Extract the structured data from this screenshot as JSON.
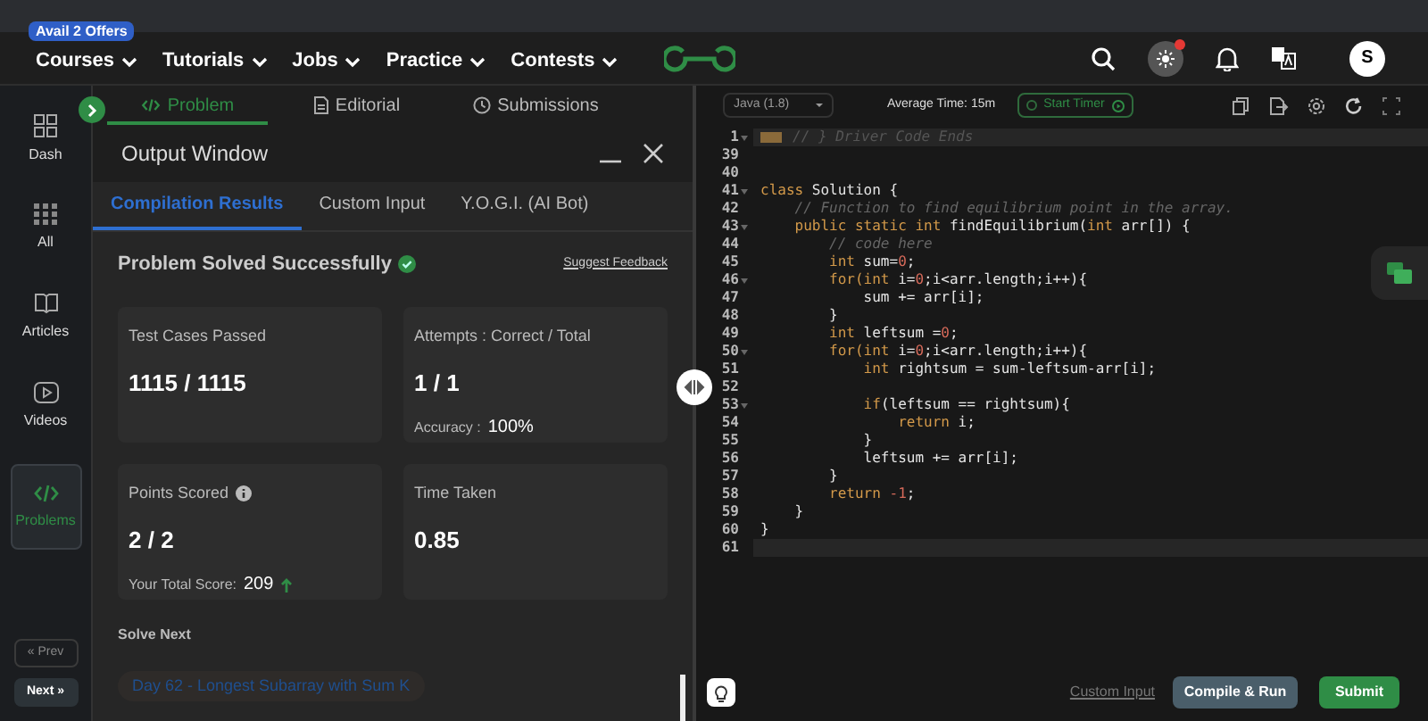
{
  "nav": {
    "offer_badge": "Avail 2 Offers",
    "menus": [
      {
        "label": "Courses"
      },
      {
        "label": "Tutorials"
      },
      {
        "label": "Jobs"
      },
      {
        "label": "Practice"
      },
      {
        "label": "Contests"
      }
    ],
    "avatar": "S",
    "notification_dot": true
  },
  "sidebar": {
    "items": [
      {
        "label": "Dash",
        "selected": false
      },
      {
        "label": "All",
        "selected": false
      },
      {
        "label": "Articles",
        "selected": false
      },
      {
        "label": "Videos",
        "selected": false
      },
      {
        "label": "Problems",
        "selected": true
      }
    ],
    "prev": "« Prev",
    "next": "Next »"
  },
  "problem_tabs": [
    {
      "label": "Problem",
      "selected": true
    },
    {
      "label": "Editorial",
      "selected": false
    },
    {
      "label": "Submissions",
      "selected": false
    }
  ],
  "output_window": {
    "title": "Output Window",
    "tabs": [
      {
        "label": "Compilation Results",
        "selected": true
      },
      {
        "label": "Custom Input",
        "selected": false
      },
      {
        "label": "Y.O.G.I. (AI Bot)",
        "selected": false
      }
    ],
    "status": "Problem Solved Successfully",
    "feedback_link": "Suggest Feedback",
    "cards": [
      {
        "label": "Test Cases Passed",
        "value": "1115 / 1115"
      },
      {
        "label": "Attempts : Correct / Total",
        "value": "1 / 1",
        "sub_label": "Accuracy :",
        "sub_value": "100%"
      },
      {
        "label": "Points Scored",
        "info": true,
        "value": "2 / 2",
        "sub_label": "Your Total Score:",
        "sub_value": "209",
        "trend_up": true
      },
      {
        "label": "Time Taken",
        "value": "0.85"
      }
    ],
    "solve_next": {
      "heading": "Solve Next",
      "items": [
        "Day 62 - Longest Subarray with Sum K"
      ]
    }
  },
  "editor": {
    "language": "Java (1.8)",
    "average_time": "Average Time: 15m",
    "timer_button": "Start Timer",
    "lines": [
      {
        "n": "1",
        "fold": true,
        "highlight": true,
        "marker": true,
        "tokens": [
          {
            "text": "// } Driver Code Ends",
            "kind": "faint"
          }
        ]
      },
      {
        "n": "39",
        "fold": false,
        "highlight": false
      },
      {
        "n": "40",
        "fold": false,
        "highlight": false
      },
      {
        "n": "41",
        "fold": true,
        "highlight": false,
        "tokens": [
          {
            "text": "class",
            "kind": "keyword"
          },
          {
            "text": " Solution {",
            "kind": "plain"
          }
        ]
      },
      {
        "n": "42",
        "fold": false,
        "highlight": false,
        "tokens": [
          {
            "text": "    // Function to find equilibrium point in the array.",
            "kind": "comment"
          }
        ]
      },
      {
        "n": "43",
        "fold": true,
        "highlight": false,
        "tokens": [
          {
            "text": "    public static int ",
            "kind": "keyword"
          },
          {
            "text": "findEquilibrium(",
            "kind": "plain"
          },
          {
            "text": "int",
            "kind": "keyword"
          },
          {
            "text": " arr[]) {",
            "kind": "plain"
          }
        ]
      },
      {
        "n": "44",
        "fold": false,
        "highlight": false,
        "tokens": [
          {
            "text": "        // code here",
            "kind": "comment"
          }
        ]
      },
      {
        "n": "45",
        "fold": false,
        "highlight": false,
        "tokens": [
          {
            "text": "        int",
            "kind": "keyword"
          },
          {
            "text": " sum=",
            "kind": "plain"
          },
          {
            "text": "0",
            "kind": "number"
          },
          {
            "text": ";",
            "kind": "plain"
          }
        ]
      },
      {
        "n": "46",
        "fold": true,
        "highlight": false,
        "tokens": [
          {
            "text": "        for(int",
            "kind": "keyword"
          },
          {
            "text": " i=",
            "kind": "plain"
          },
          {
            "text": "0",
            "kind": "number"
          },
          {
            "text": ";i<arr.length;i++){",
            "kind": "plain"
          }
        ]
      },
      {
        "n": "47",
        "fold": false,
        "highlight": false,
        "tokens": [
          {
            "text": "            sum += arr[i];",
            "kind": "plain"
          }
        ]
      },
      {
        "n": "48",
        "fold": false,
        "highlight": false,
        "tokens": [
          {
            "text": "        }",
            "kind": "plain"
          }
        ]
      },
      {
        "n": "49",
        "fold": false,
        "highlight": false,
        "tokens": [
          {
            "text": "        int",
            "kind": "keyword"
          },
          {
            "text": " leftsum =",
            "kind": "plain"
          },
          {
            "text": "0",
            "kind": "number"
          },
          {
            "text": ";",
            "kind": "plain"
          }
        ]
      },
      {
        "n": "50",
        "fold": true,
        "highlight": false,
        "tokens": [
          {
            "text": "        for(int",
            "kind": "keyword"
          },
          {
            "text": " i=",
            "kind": "plain"
          },
          {
            "text": "0",
            "kind": "number"
          },
          {
            "text": ";i<arr.length;i++){",
            "kind": "plain"
          }
        ]
      },
      {
        "n": "51",
        "fold": false,
        "highlight": false,
        "tokens": [
          {
            "text": "            int",
            "kind": "keyword"
          },
          {
            "text": " rightsum = sum-leftsum-arr[i];",
            "kind": "plain"
          }
        ]
      },
      {
        "n": "52",
        "fold": false,
        "highlight": false
      },
      {
        "n": "53",
        "fold": true,
        "highlight": false,
        "tokens": [
          {
            "text": "            if",
            "kind": "keyword"
          },
          {
            "text": "(leftsum == rightsum){",
            "kind": "plain"
          }
        ]
      },
      {
        "n": "54",
        "fold": false,
        "highlight": false,
        "tokens": [
          {
            "text": "                return",
            "kind": "keyword"
          },
          {
            "text": " i;",
            "kind": "plain"
          }
        ]
      },
      {
        "n": "55",
        "fold": false,
        "highlight": false,
        "tokens": [
          {
            "text": "            }",
            "kind": "plain"
          }
        ]
      },
      {
        "n": "56",
        "fold": false,
        "highlight": false,
        "tokens": [
          {
            "text": "            leftsum += arr[i];",
            "kind": "plain"
          }
        ]
      },
      {
        "n": "57",
        "fold": false,
        "highlight": false,
        "tokens": [
          {
            "text": "        }",
            "kind": "plain"
          }
        ]
      },
      {
        "n": "58",
        "fold": false,
        "highlight": false,
        "tokens": [
          {
            "text": "        return",
            "kind": "keyword"
          },
          {
            "text": " -1",
            "kind": "number"
          },
          {
            "text": ";",
            "kind": "plain"
          }
        ]
      },
      {
        "n": "59",
        "fold": false,
        "highlight": false,
        "tokens": [
          {
            "text": "    }",
            "kind": "plain"
          }
        ]
      },
      {
        "n": "60",
        "fold": false,
        "highlight": false,
        "tokens": [
          {
            "text": "}",
            "kind": "plain"
          }
        ]
      },
      {
        "n": "61",
        "fold": false,
        "highlight": true
      }
    ],
    "custom_input": "Custom Input",
    "compile_button": "Compile & Run",
    "submit_button": "Submit"
  }
}
